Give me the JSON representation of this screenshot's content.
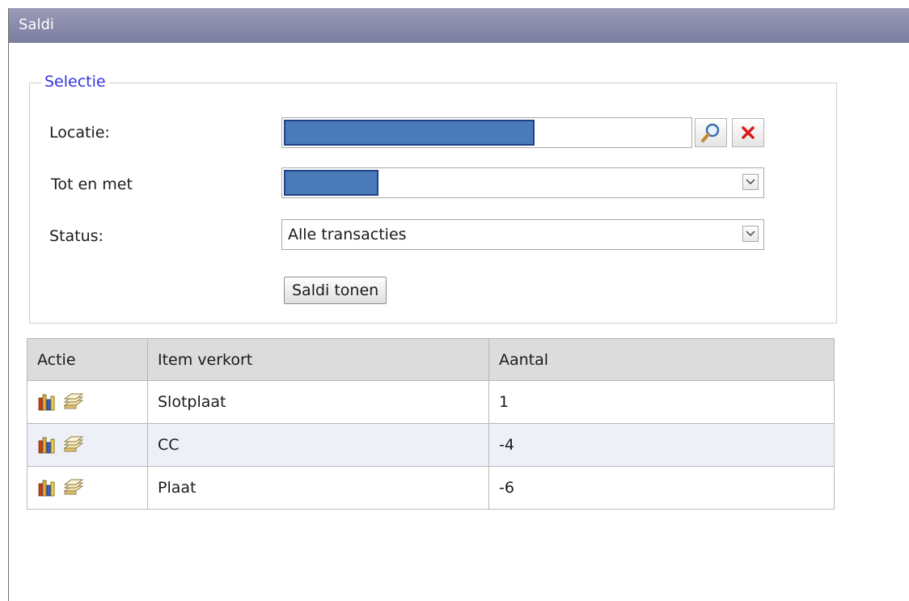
{
  "window": {
    "title": "Saldi"
  },
  "selectie": {
    "legend": "Selectie",
    "locatie_label": "Locatie:",
    "totenmet_label": "Tot en met",
    "status_label": "Status:",
    "status_value": "Alle transacties",
    "submit_label": "Saldi tonen"
  },
  "table": {
    "headers": [
      "Actie",
      "Item verkort",
      "Aantal"
    ],
    "rows": [
      {
        "item": "Slotplaat",
        "aantal": "1"
      },
      {
        "item": "CC",
        "aantal": "-4"
      },
      {
        "item": "Plaat",
        "aantal": "-6"
      }
    ]
  },
  "colors": {
    "titlebar": "#8686aa",
    "legend": "#3333dd",
    "redaction": "#4a7ab8",
    "header_row": "#dcdcdc",
    "alt_row": "#eef0f8"
  },
  "icons": [
    "search-icon",
    "clear-x-icon",
    "dropdown-arrow-icon",
    "chart-books-icon",
    "stack-papers-icon"
  ]
}
